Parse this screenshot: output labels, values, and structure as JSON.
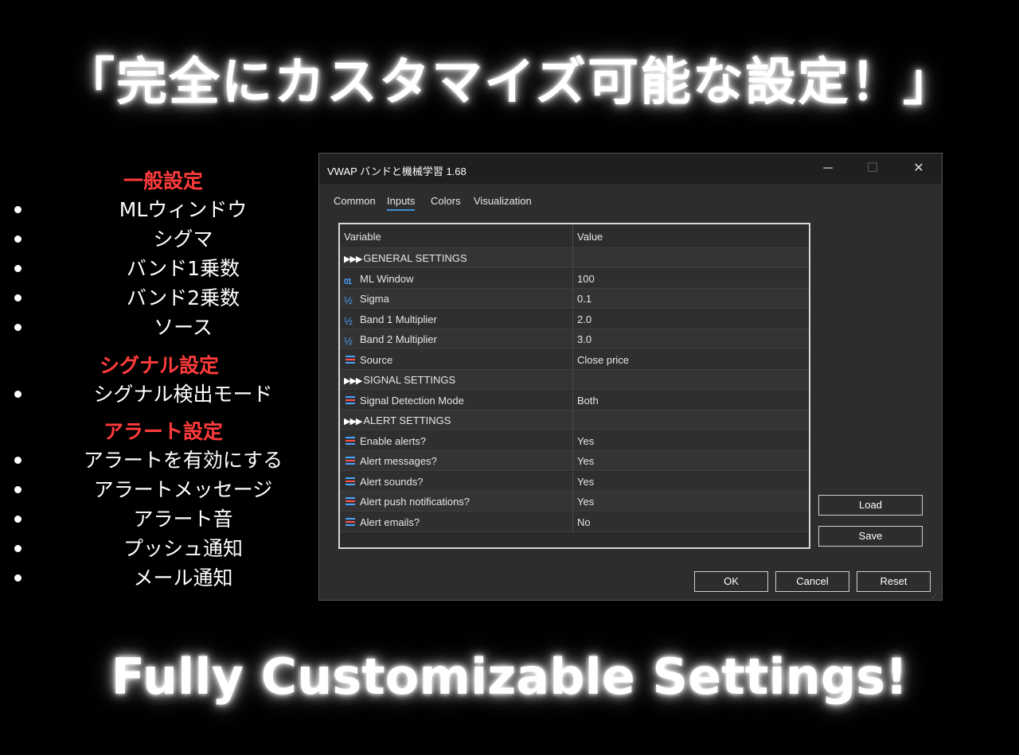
{
  "headline_jp": "「完全にカスタマイズ可能な設定！」",
  "headline_en": "Fully Customizable Settings!",
  "left_panel": {
    "sections": [
      {
        "title": "一般設定",
        "items": [
          "MLウィンドウ",
          "シグマ",
          "バンド1乗数",
          "バンド2乗数",
          "ソース"
        ]
      },
      {
        "title": "シグナル設定",
        "items": [
          "シグナル検出モード"
        ]
      },
      {
        "title": "アラート設定",
        "items": [
          "アラートを有効にする",
          "アラートメッセージ",
          "アラート音",
          "プッシュ通知",
          "メール通知"
        ]
      }
    ]
  },
  "dialog": {
    "title": "VWAP バンドと機械学習 1.68",
    "window_buttons": {
      "minimize": "─",
      "maximize": "☐",
      "close": "✕"
    },
    "tabs": [
      "Common",
      "Inputs",
      "Colors",
      "Visualization"
    ],
    "active_tab": "Inputs",
    "columns": {
      "variable": "Variable",
      "value": "Value"
    },
    "rows": [
      {
        "icon": "section-arrows",
        "variable": "GENERAL SETTINGS",
        "value": ""
      },
      {
        "icon": "int-icon",
        "variable": "ML Window",
        "value": "100"
      },
      {
        "icon": "double-icon",
        "variable": "Sigma",
        "value": "0.1"
      },
      {
        "icon": "double-icon",
        "variable": "Band 1 Multiplier",
        "value": "2.0"
      },
      {
        "icon": "double-icon",
        "variable": "Band 2 Multiplier",
        "value": "3.0"
      },
      {
        "icon": "enum-icon",
        "variable": "Source",
        "value": "Close price"
      },
      {
        "icon": "section-arrows",
        "variable": "SIGNAL SETTINGS",
        "value": ""
      },
      {
        "icon": "enum-icon",
        "variable": "Signal Detection Mode",
        "value": "Both"
      },
      {
        "icon": "section-arrows",
        "variable": "ALERT SETTINGS",
        "value": ""
      },
      {
        "icon": "enum-icon",
        "variable": "Enable alerts?",
        "value": "Yes"
      },
      {
        "icon": "enum-icon",
        "variable": "Alert messages?",
        "value": "Yes"
      },
      {
        "icon": "enum-icon",
        "variable": "Alert sounds?",
        "value": "Yes"
      },
      {
        "icon": "enum-icon",
        "variable": "Alert push notifications?",
        "value": "Yes"
      },
      {
        "icon": "enum-icon",
        "variable": "Alert emails?",
        "value": "No"
      }
    ],
    "buttons": {
      "load": "Load",
      "save": "Save",
      "ok": "OK",
      "cancel": "Cancel",
      "reset": "Reset"
    }
  },
  "colors": {
    "section_title": "#ff3b3b",
    "accent": "#3d8fd6",
    "icon_blue": "#4aa3ff"
  }
}
